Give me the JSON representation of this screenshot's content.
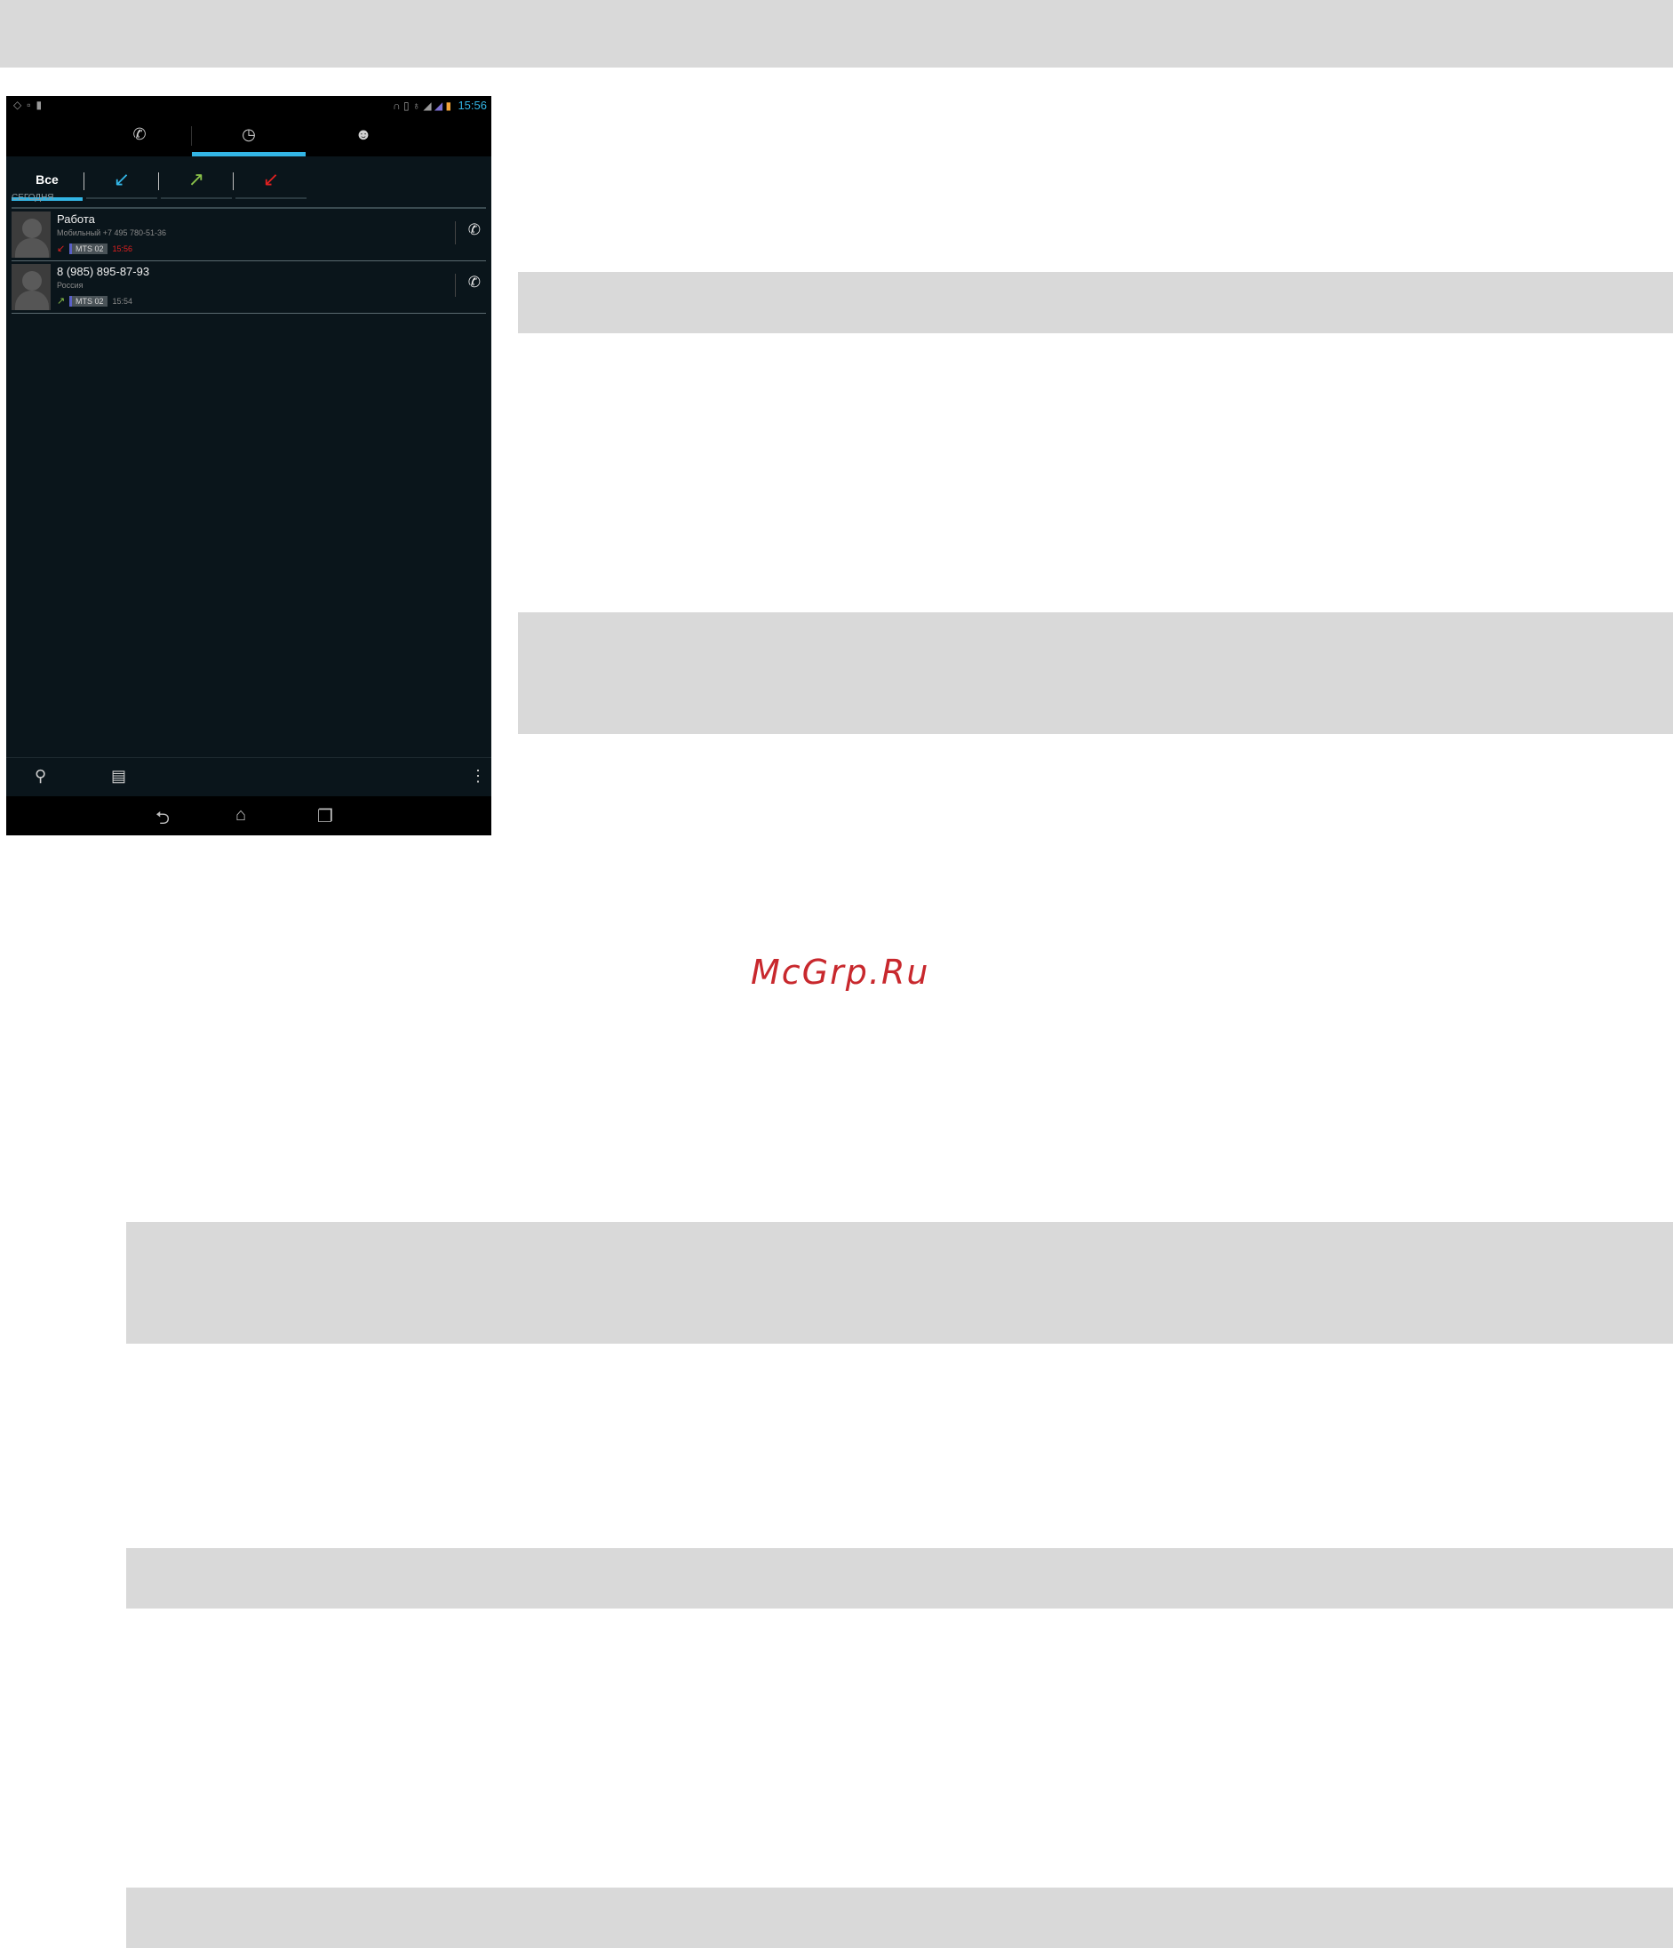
{
  "phone": {
    "status_left_icons": [
      "location-icon",
      "image-icon",
      "battery-small-icon"
    ],
    "status_right_icons": [
      "headset-icon",
      "vibrate-icon",
      "alarm-icon",
      "signal-icon",
      "signal-icon",
      "battery-icon"
    ],
    "status_time": "15:56",
    "main_tabs": [
      {
        "icon": "phone-icon",
        "glyph": "✆"
      },
      {
        "icon": "clock-icon",
        "glyph": "◷",
        "active": true
      },
      {
        "icon": "contact-icon",
        "glyph": "☻"
      }
    ],
    "filters": {
      "all_label": "Все",
      "incoming_glyph": "↙",
      "outgoing_glyph": "↗",
      "missed_glyph": "↙"
    },
    "section_label": "СЕГОДНЯ",
    "calls": [
      {
        "name": "Работа",
        "subtitle": "Мобильный +7 495 780-51-36",
        "direction_glyph": "↙",
        "direction_color": "#e02020",
        "sim": "MTS 02",
        "time": "15:56",
        "time_color": "#e02020"
      },
      {
        "name": "8 (985) 895-87-93",
        "subtitle": "Россия",
        "direction_glyph": "↗",
        "direction_color": "#8bc34a",
        "sim": "MTS 02",
        "time": "15:54",
        "time_color": "#8a8a8a"
      }
    ],
    "call_glyph": "✆",
    "bottom_icons": [
      "search-icon",
      "sim-card-icon",
      "overflow-menu-icon"
    ],
    "nav_icons": [
      "back-icon",
      "home-icon",
      "recents-icon"
    ]
  },
  "colors": {
    "accent": "#33b5e5",
    "incoming": "#33b5e5",
    "outgoing": "#8bc34a",
    "missed": "#e02020",
    "band": "#d9d9d9"
  },
  "watermark": "McGrp.Ru"
}
